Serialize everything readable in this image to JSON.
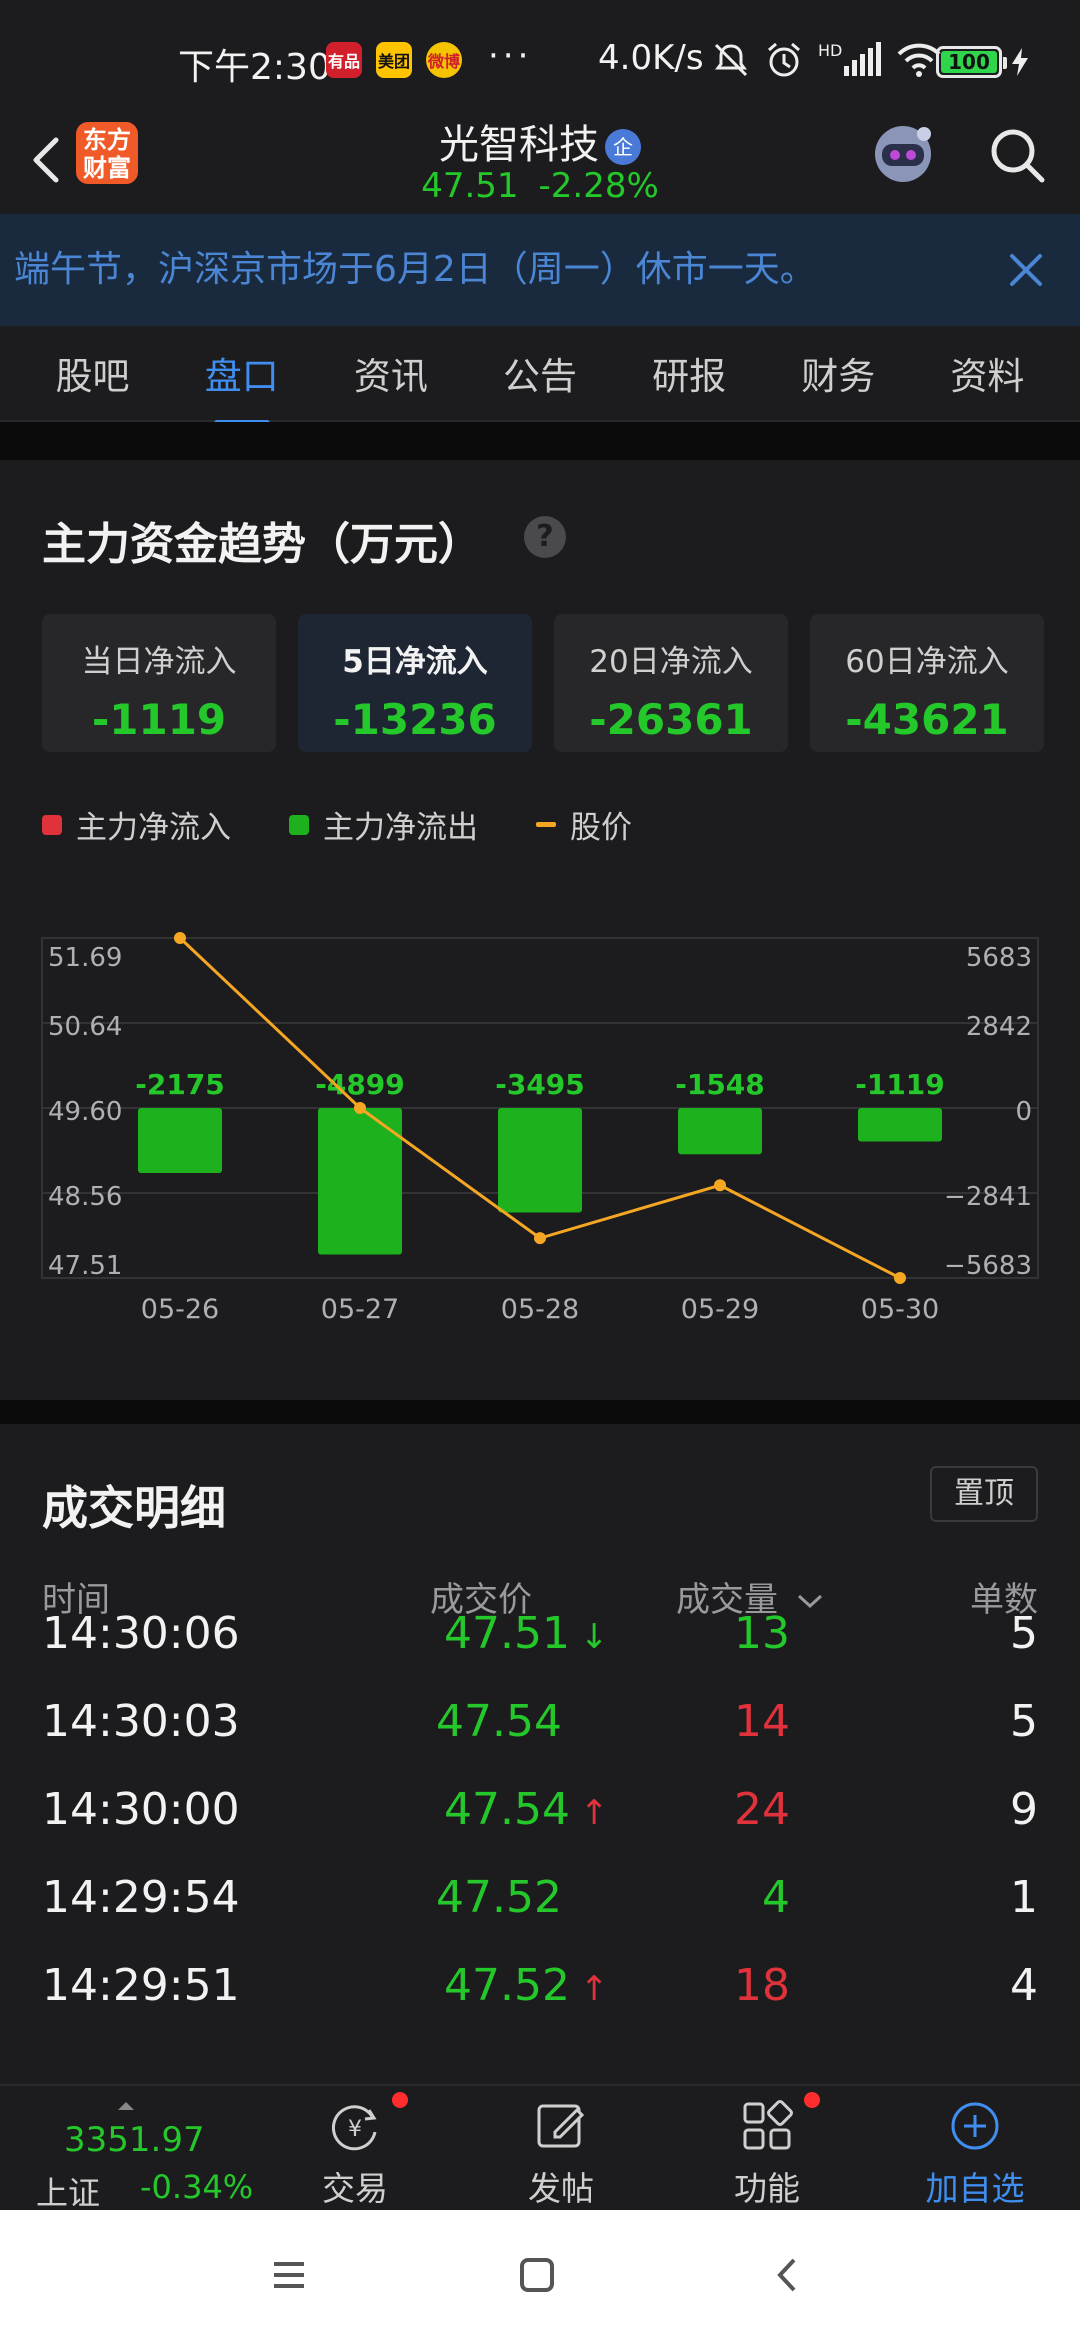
{
  "status_bar": {
    "time": "下午2:30",
    "app_icons": [
      "有品",
      "美团",
      "微博"
    ],
    "more": "···",
    "net_speed": "4.0K/s",
    "network": "HD",
    "battery": "100"
  },
  "header": {
    "brand_logo": "东方\n财富",
    "stock_name": "光智科技",
    "enterprise_badge": "企",
    "price": "47.51",
    "change_pct": "-2.28%"
  },
  "notice": {
    "text": "端午节，沪深京市场于6月2日（周一）休市一天。"
  },
  "tabs": [
    "股吧",
    "盘口",
    "资讯",
    "公告",
    "研报",
    "财务",
    "资料"
  ],
  "active_tab": 1,
  "capital_flow": {
    "title": "主力资金趋势（万元）",
    "help": "?",
    "boxes": [
      {
        "label": "当日净流入",
        "value": "-1119"
      },
      {
        "label": "5日净流入",
        "value": "-13236"
      },
      {
        "label": "20日净流入",
        "value": "-26361"
      },
      {
        "label": "60日净流入",
        "value": "-43621"
      }
    ],
    "active_box": 1,
    "legend": [
      {
        "label": "主力净流入",
        "color": "#e0323a"
      },
      {
        "label": "主力净流出",
        "color": "#1db21d"
      },
      {
        "label": "股价",
        "color": "#f5a623"
      }
    ]
  },
  "chart_data": {
    "type": "bar",
    "categories": [
      "05-26",
      "05-27",
      "05-28",
      "05-29",
      "05-30"
    ],
    "series": [
      {
        "name": "主力净流出",
        "values": [
          -2175,
          -4899,
          -3495,
          -1548,
          -1119
        ],
        "color": "#1db21d"
      },
      {
        "name": "股价",
        "type": "line",
        "values": [
          51.69,
          49.6,
          48.0,
          48.65,
          47.51
        ],
        "color": "#f5a623"
      }
    ],
    "left_ticks": [
      "51.69",
      "50.64",
      "49.60",
      "48.56",
      "47.51"
    ],
    "right_ticks": [
      "5683",
      "2842",
      "0",
      "−2841",
      "−5683"
    ],
    "ylim_left": [
      47.51,
      51.69
    ],
    "ylim_right": [
      -5683,
      5683
    ],
    "bar_labels": [
      "-2175",
      "-4899",
      "-3495",
      "-1548",
      "-1119"
    ]
  },
  "trades": {
    "title": "成交明细",
    "pin_label": "置顶",
    "headers": {
      "time": "时间",
      "price": "成交价",
      "volume": "成交量",
      "count": "单数"
    },
    "rows": [
      {
        "time": "14:30:06",
        "price": "47.51",
        "arrow": "↓",
        "volume": "13",
        "vol_color": "#25c82a",
        "count": "5"
      },
      {
        "time": "14:30:03",
        "price": "47.54",
        "arrow": "",
        "volume": "14",
        "vol_color": "#e0323a",
        "count": "5"
      },
      {
        "time": "14:30:00",
        "price": "47.54",
        "arrow": "↑",
        "volume": "24",
        "vol_color": "#e0323a",
        "count": "9"
      },
      {
        "time": "14:29:54",
        "price": "47.52",
        "arrow": "",
        "volume": "4",
        "vol_color": "#25c82a",
        "count": "1"
      },
      {
        "time": "14:29:51",
        "price": "47.52",
        "arrow": "↑",
        "volume": "18",
        "vol_color": "#e0323a",
        "count": "4"
      }
    ]
  },
  "bottom_nav": {
    "index_value": "3351.97",
    "index_name": "上证",
    "index_change": "-0.34%",
    "items": [
      {
        "label": "交易",
        "icon": "trade-icon",
        "dot": true
      },
      {
        "label": "发帖",
        "icon": "post-icon",
        "dot": false
      },
      {
        "label": "功能",
        "icon": "functions-icon",
        "dot": true
      },
      {
        "label": "加自选",
        "icon": "add-watchlist-icon",
        "dot": false
      }
    ]
  }
}
